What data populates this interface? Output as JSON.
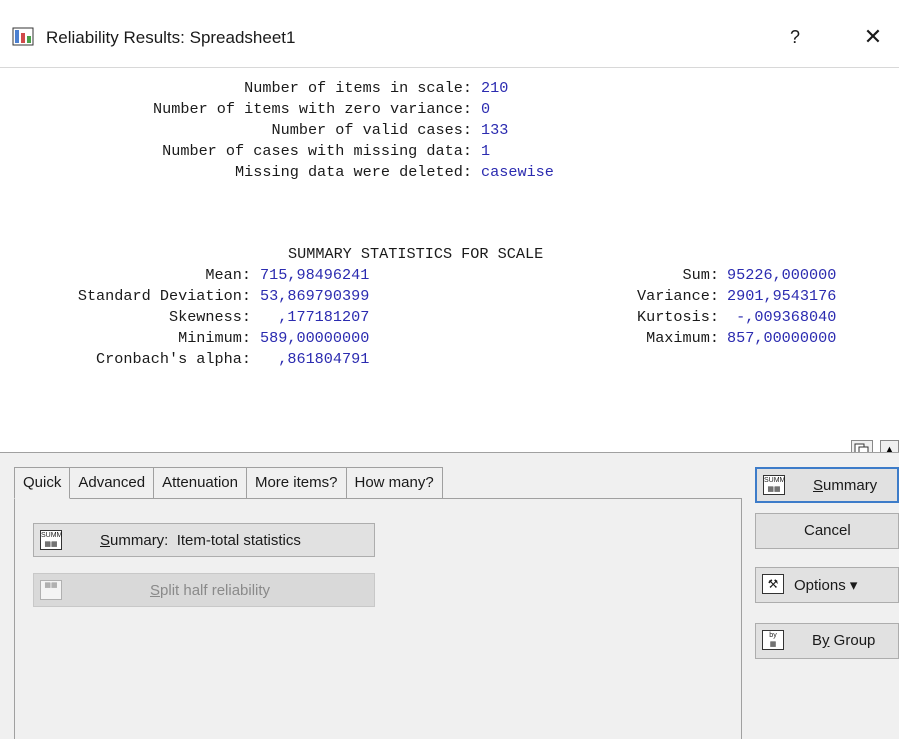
{
  "window": {
    "title": "Reliability Results: Spreadsheet1",
    "help_label": "?",
    "close_label": "✕"
  },
  "output": {
    "info_rows": [
      {
        "label": "Number of items in scale:",
        "value": "210"
      },
      {
        "label": "Number of items with zero variance:",
        "value": "0"
      },
      {
        "label": "Number of valid cases:",
        "value": "133"
      },
      {
        "label": "Number of cases with missing data:",
        "value": "1"
      },
      {
        "label": "Missing data were deleted:",
        "value": "casewise"
      }
    ],
    "summary_heading": "SUMMARY STATISTICS FOR SCALE",
    "left_stats": [
      {
        "label": "Mean:",
        "value": "715,98496241"
      },
      {
        "label": "Standard Deviation:",
        "value": "53,869790399"
      },
      {
        "label": "Skewness:",
        "value": "  ,177181207"
      },
      {
        "label": "Minimum:",
        "value": "589,00000000"
      },
      {
        "label": "Cronbach's alpha:",
        "value": "  ,861804791"
      }
    ],
    "right_stats": [
      {
        "label": "Sum:",
        "value": "95226,000000"
      },
      {
        "label": "Variance:",
        "value": "2901,9543176"
      },
      {
        "label": "Kurtosis:",
        "value": " -,009368040"
      },
      {
        "label": "Maximum:",
        "value": "857,00000000"
      }
    ]
  },
  "tabs": [
    "Quick",
    "Advanced",
    "Attenuation",
    "More items?",
    "How many?"
  ],
  "quick": {
    "summary_button": "ummary:  Item-total statistics",
    "summary_mnemonic": "S",
    "split_button_pre": "S",
    "split_button_rest": "plit half reliability"
  },
  "side_buttons": {
    "summary_mnemonic": "S",
    "summary_rest": "ummary",
    "cancel": "Cancel",
    "options": "Options ▾",
    "by_group_pre": "B",
    "by_group_mnemonic": "y",
    "by_group_rest": " Group"
  },
  "icons": {
    "app": "reliability-app-icon",
    "copy": "copy-icon",
    "scroll": "scroll-arrow-icon",
    "summary_table": "summary-table-icon",
    "options": "options-icon",
    "by_group": "by-group-icon"
  },
  "colors": {
    "value_text": "#2b2bb0",
    "accent_border": "#3d7cc9"
  }
}
